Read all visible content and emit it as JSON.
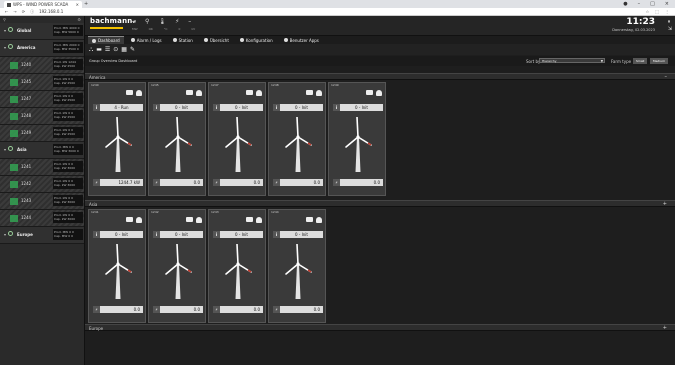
{
  "browser": {
    "tab_title": "WPS - WIND POWER SCADA",
    "url": "192.168.0.1",
    "close": "×",
    "new_tab": "+",
    "nav": [
      "←",
      "→",
      "⟳"
    ]
  },
  "sidebar": {
    "search_icon": "search-icon",
    "items": [
      {
        "type": "group",
        "label": "Global",
        "stat1": "Prod. MW  4000 0",
        "stat2": "Cap. MW  5600 0"
      },
      {
        "type": "group",
        "label": "America",
        "stat1": "Prod. MW  2000 0",
        "stat2": "Cap. MW  3500 0"
      },
      {
        "type": "turbine",
        "label": "1240",
        "stat1": "Prod. kW  1244",
        "stat2": "Cap. kW  2500"
      },
      {
        "type": "turbine",
        "label": "1245",
        "stat1": "Prod. kW  0 0",
        "stat2": "Cap. kW  2500"
      },
      {
        "type": "turbine",
        "label": "1247",
        "stat1": "Prod. kW  0 0",
        "stat2": "Cap. kW  2500"
      },
      {
        "type": "turbine",
        "label": "1248",
        "stat1": "Prod. kW  0 0",
        "stat2": "Cap. kW  2500"
      },
      {
        "type": "turbine",
        "label": "1249",
        "stat1": "Prod. kW  0 0",
        "stat2": "Cap. kW  2500"
      },
      {
        "type": "group",
        "label": "Asia",
        "stat1": "Prod. MW  0 0",
        "stat2": "Cap. MW  3000 0"
      },
      {
        "type": "turbine",
        "label": "1241",
        "stat1": "Prod. kW  0 0",
        "stat2": "Cap. kW  3000"
      },
      {
        "type": "turbine",
        "label": "1242",
        "stat1": "Prod. kW  0 0",
        "stat2": "Cap. kW  3000"
      },
      {
        "type": "turbine",
        "label": "1243",
        "stat1": "Prod. kW  0 0",
        "stat2": "Cap. kW  3000"
      },
      {
        "type": "turbine",
        "label": "1244",
        "stat1": "Prod. kW  0 0",
        "stat2": "Cap. kW  3000"
      },
      {
        "type": "group",
        "label": "Europe",
        "stat1": "Prod. MW  0 0",
        "stat2": "Cap. MW  0 0"
      }
    ]
  },
  "header": {
    "logo": "bachmann.",
    "icons": [
      "⇥",
      "⚲",
      "🌡",
      "⚡",
      "–"
    ],
    "subs": [
      "MW",
      "ΟΚ",
      "°C",
      "0",
      "kV"
    ],
    "time": "11:23",
    "date": "Donnerstag, 02.03.2023"
  },
  "tabs": [
    {
      "label": "Dashboard",
      "active": true
    },
    {
      "label": "Alarm / Logs",
      "active": false
    },
    {
      "label": "Station",
      "active": false
    },
    {
      "label": "Übersicht",
      "active": false
    },
    {
      "label": "Konfiguration",
      "active": false
    },
    {
      "label": "Benutzer Apps",
      "active": false
    }
  ],
  "filterbar": {
    "title": "Group Overview Dashboard",
    "sort_label": "Sort by",
    "sort_value": "Hierarchy",
    "filter_label": "Farm type",
    "btn_small": "Small",
    "btn_medium": "Medium"
  },
  "sections": [
    {
      "title": "America",
      "toggle": "–"
    },
    {
      "title": "Asia",
      "toggle": "+"
    },
    {
      "title": "Europe",
      "toggle": "+"
    }
  ],
  "cards_america": [
    {
      "name": "1240",
      "status_value": "4 - Run",
      "power_value": "1244.7 kW"
    },
    {
      "name": "1245",
      "status_value": "0 - Init",
      "power_value": "0.0"
    },
    {
      "name": "1247",
      "status_value": "0 - Init",
      "power_value": "0.0"
    },
    {
      "name": "1248",
      "status_value": "0 - Init",
      "power_value": "0.0"
    },
    {
      "name": "1249",
      "status_value": "0 - Init",
      "power_value": "0.0"
    }
  ],
  "cards_asia": [
    {
      "name": "1241",
      "status_value": "0 - Init",
      "power_value": "0.0"
    },
    {
      "name": "1242",
      "status_value": "0 - Init",
      "power_value": "0.0"
    },
    {
      "name": "1243",
      "status_value": "0 - Init",
      "power_value": "0.0"
    },
    {
      "name": "1244",
      "status_value": "0 - Init",
      "power_value": "0.0"
    }
  ],
  "colors": {
    "accent": "#f3c200",
    "blade": "#ffffff",
    "tower": "#e5e5e5",
    "alert": "#c0392b"
  }
}
